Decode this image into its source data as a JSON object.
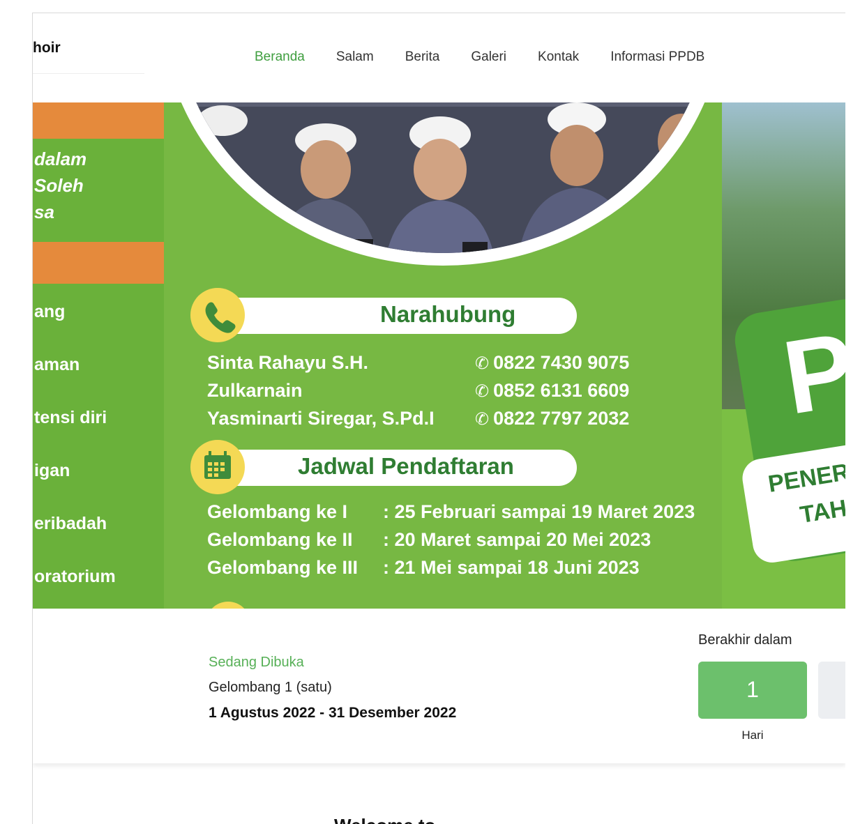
{
  "header": {
    "brand": "hoir",
    "nav": [
      {
        "label": "Beranda",
        "active": true
      },
      {
        "label": "Salam",
        "active": false
      },
      {
        "label": "Berita",
        "active": false
      },
      {
        "label": "Galeri",
        "active": false
      },
      {
        "label": "Kontak",
        "active": false
      },
      {
        "label": "Informasi PPDB",
        "active": false
      }
    ]
  },
  "banner": {
    "left_slide": {
      "tagline": [
        "dalam",
        "Soleh",
        "sa"
      ],
      "facilities": [
        "ang",
        "aman",
        "tensi diri",
        "igan",
        "eribadah",
        "oratorium"
      ]
    },
    "center_slide": {
      "contact_title": "Narahubung",
      "contacts": [
        {
          "name": "Sinta Rahayu S.H.",
          "phone": "0822 7430 9075"
        },
        {
          "name": "Zulkarnain",
          "phone": "0852 6131 6609"
        },
        {
          "name": "Yasminarti Siregar, S.Pd.I",
          "phone": "0822 7797 2032"
        }
      ],
      "schedule_title": "Jadwal Pendaftaran",
      "schedule": [
        {
          "label": "Gelombang ke I",
          "date": ": 25 Februari sampai 19 Maret 2023"
        },
        {
          "label": "Gelombang ke II",
          "date": ": 20 Maret sampai 20 Mei 2023"
        },
        {
          "label": "Gelombang ke III",
          "date": ": 21 Mei sampai 18 Juni 2023"
        }
      ]
    },
    "right_slide": {
      "letter": "P",
      "line1": "PENER",
      "line2": "TAH"
    }
  },
  "registration": {
    "status": "Sedang Dibuka",
    "wave": "Gelombang 1 (satu)",
    "range": "1 Agustus 2022 - 31 Desember 2022",
    "countdown_label": "Berakhir dalam",
    "days_value": "1",
    "days_label": "Hari"
  },
  "welcome": {
    "text": "Welcome to"
  },
  "icons": {
    "phone": "phone-icon",
    "calendar": "calendar-icon"
  },
  "colors": {
    "accent_green": "#3f9e3f",
    "banner_green": "#77b843",
    "orange": "#e58a3c",
    "yellow": "#f4d955",
    "countdown_green": "#6cc06c"
  }
}
